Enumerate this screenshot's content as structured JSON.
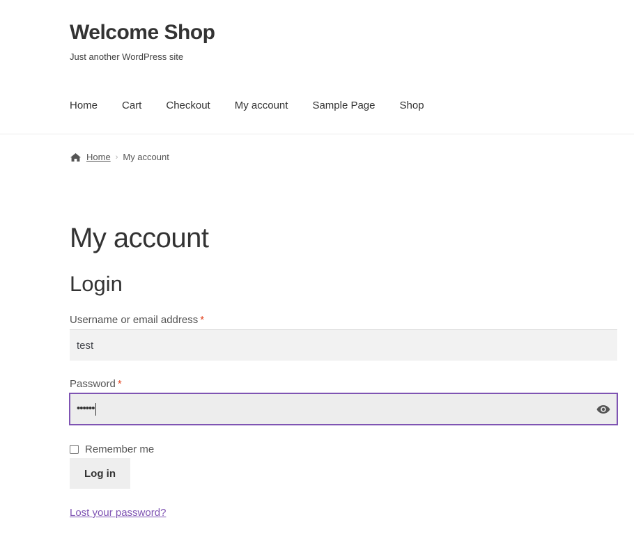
{
  "site": {
    "title": "Welcome Shop",
    "tagline": "Just another WordPress site"
  },
  "nav": {
    "items": [
      {
        "label": "Home"
      },
      {
        "label": "Cart"
      },
      {
        "label": "Checkout"
      },
      {
        "label": "My account"
      },
      {
        "label": "Sample Page"
      },
      {
        "label": "Shop"
      }
    ]
  },
  "breadcrumb": {
    "icon": "home-icon",
    "home_label": "Home",
    "separator": "›",
    "current": "My account"
  },
  "page": {
    "title": "My account",
    "section_heading": "Login"
  },
  "form": {
    "username_label": "Username or email address",
    "username_value": "test",
    "password_label": "Password",
    "password_value": "••••••",
    "required_mark": "*",
    "show_password_icon": "eye-icon",
    "remember_label": "Remember me",
    "remember_checked": false,
    "submit_label": "Log in",
    "lost_password_label": "Lost your password?"
  },
  "colors": {
    "accent": "#7f54b3",
    "required": "#e2401c",
    "input_bg": "#f2f2f2",
    "button_bg": "#eeeeee"
  }
}
